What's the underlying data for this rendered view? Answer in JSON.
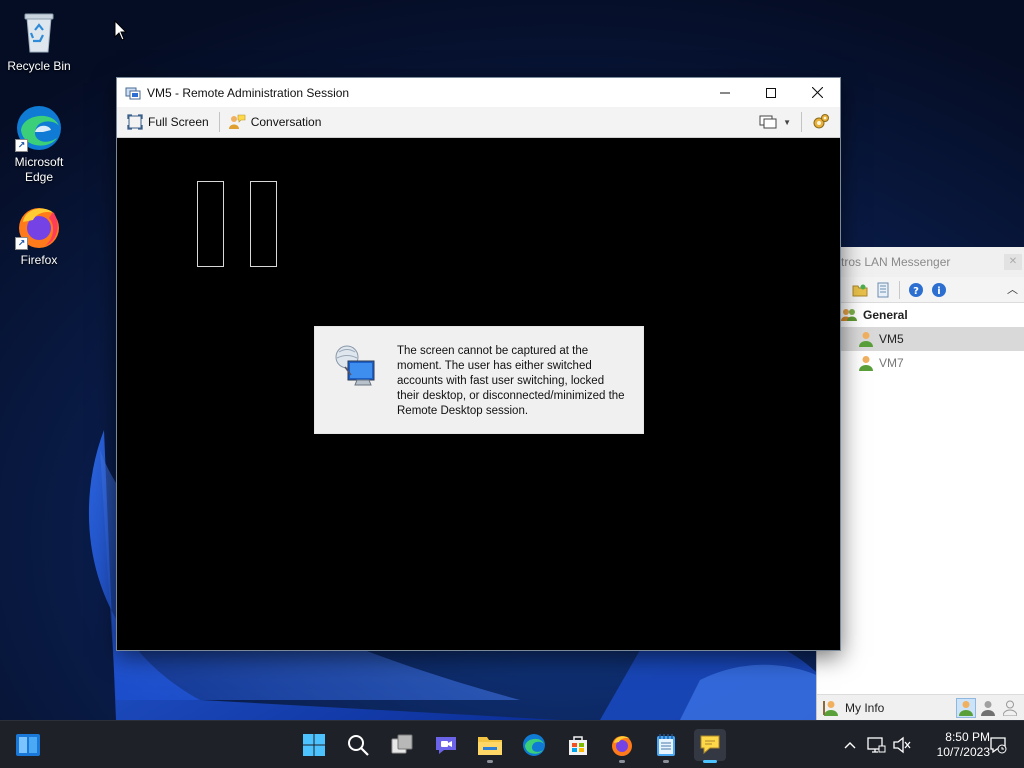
{
  "desktop": {
    "icons": [
      {
        "label": "Recycle Bin"
      },
      {
        "label": "Microsoft\nEdge"
      },
      {
        "label": "Firefox"
      }
    ]
  },
  "remote_window": {
    "title": "VM5 - Remote Administration Session",
    "toolbar": {
      "full_screen": "Full Screen",
      "conversation": "Conversation"
    },
    "message": "The screen cannot be captured at the moment. The user has either switched accounts with fast user switching, locked their desktop, or disconnected/minimized the Remote Desktop session."
  },
  "messenger": {
    "title": "tros LAN Messenger",
    "group": "General",
    "users": [
      {
        "name": "VM5",
        "selected": true,
        "status": "online"
      },
      {
        "name": "VM7",
        "selected": false,
        "status": "offline"
      }
    ],
    "footer": {
      "my_info": "My Info"
    }
  },
  "taskbar": {
    "time": "8:50 PM",
    "date": "10/7/2023",
    "apps": [
      "start",
      "search",
      "task-view",
      "chat",
      "file-explorer",
      "edge",
      "store",
      "firefox",
      "notepad",
      "lan-messenger"
    ]
  },
  "colors": {
    "accent": "#4cc2ff",
    "taskbar": "#1e2128",
    "dialog": "#f0f0f0"
  }
}
